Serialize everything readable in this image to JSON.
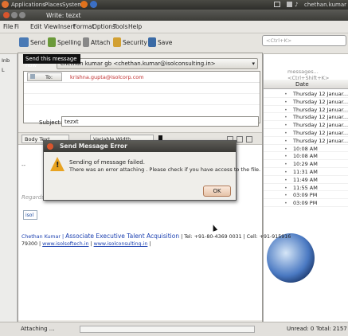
{
  "panel": {
    "menus": [
      "Applications",
      "Places",
      "System"
    ],
    "user": "chethan.kumar"
  },
  "window": {
    "title": "Write: tezxt"
  },
  "menubar": [
    "File",
    "Edit",
    "View",
    "Insert",
    "Format",
    "Options",
    "Tools",
    "Help"
  ],
  "toolbar": {
    "send": "Send",
    "spelling": "Spelling",
    "attach": "Attach",
    "security": "Security",
    "save": "Save",
    "tooltip": "Send this message now"
  },
  "compose": {
    "from_label": "From:",
    "from_value": "chethan kumar gb <chethan.kumar@isolconsulting.in>",
    "to_label": "To:",
    "to_value": "krishna.gupta@isolcorp.com",
    "subject_label": "Subject:",
    "subject_value": "tezxt",
    "format_style": "Body Text",
    "format_width": "Variable Width",
    "body_dots": "--",
    "regards": "Regards",
    "logo_text": "isol",
    "sig_name": "Chethan Kumar",
    "sig_title": "Associate Executive Talent Acquisition",
    "sig_phone": "| Tel: +91-80-4369 0031 | Cell: +91-915916",
    "sig_cont": "79300 |",
    "sig_link1": "www.isolsoftech.in",
    "sig_link2": "www.isolconsulting.in"
  },
  "dialog": {
    "title": "Send Message Error",
    "line1": "Sending of message failed.",
    "line2": "There was an error attaching . Please check if you have access to the file.",
    "ok": "OK"
  },
  "message_list": {
    "search_placeholder": "messages... <Ctrl+Shift+K>",
    "date_header": "Date",
    "quick_search": "<Ctrl+K>",
    "dates": [
      "Thursday 12 Januar...",
      "Thursday 12 Januar...",
      "Thursday 12 Januar...",
      "Thursday 12 Januar...",
      "Thursday 12 Januar...",
      "Thursday 12 Januar...",
      "Thursday 12 Januar...",
      "10:08 AM",
      "10:08 AM",
      "10:29 AM",
      "11:31 AM",
      "11:49 AM",
      "11:55 AM",
      "03:09 PM",
      "03:09 PM"
    ]
  },
  "left_pane": {
    "items": [
      "Inb",
      "L"
    ]
  },
  "status": {
    "attaching": "Attaching ...",
    "unread": "Unread: 0",
    "total": "Total: 2157"
  }
}
